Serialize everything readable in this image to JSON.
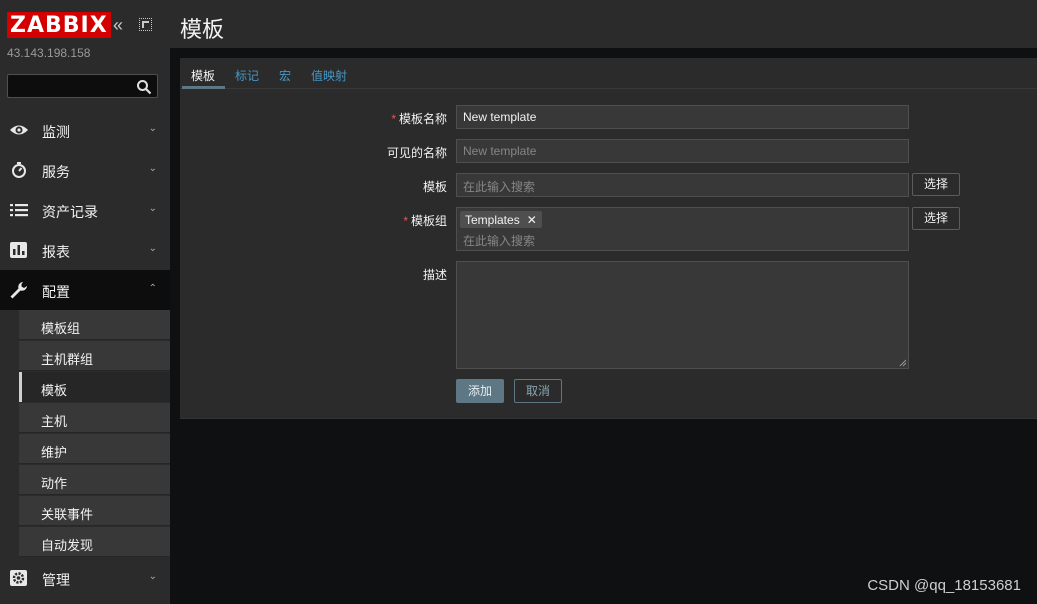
{
  "sidebar": {
    "logo": "ZABBIX",
    "collapse_glyph": "«",
    "server_ip": "43.143.198.158",
    "search": {
      "value": "",
      "placeholder": ""
    },
    "nav": [
      {
        "label": "监测",
        "icon": "eye-icon"
      },
      {
        "label": "服务",
        "icon": "stopwatch-icon"
      },
      {
        "label": "资产记录",
        "icon": "list-icon"
      },
      {
        "label": "报表",
        "icon": "bar-chart-icon"
      },
      {
        "label": "配置",
        "icon": "wrench-icon"
      },
      {
        "label": "管理",
        "icon": "gear-icon"
      }
    ],
    "config_sub": [
      {
        "label": "模板组"
      },
      {
        "label": "主机群组"
      },
      {
        "label": "模板"
      },
      {
        "label": "主机"
      },
      {
        "label": "维护"
      },
      {
        "label": "动作"
      },
      {
        "label": "关联事件"
      },
      {
        "label": "自动发现"
      }
    ]
  },
  "header": {
    "title": "模板"
  },
  "tabs": [
    {
      "label": "模板"
    },
    {
      "label": "标记"
    },
    {
      "label": "宏"
    },
    {
      "label": "值映射"
    }
  ],
  "form": {
    "template_name": {
      "label": "模板名称",
      "value": "New template"
    },
    "visible_name": {
      "label": "可见的名称",
      "placeholder": "New template"
    },
    "templates": {
      "label": "模板",
      "placeholder": "在此输入搜索",
      "select_label": "选择"
    },
    "groups": {
      "label": "模板组",
      "chip": "Templates",
      "placeholder": "在此输入搜索",
      "select_label": "选择"
    },
    "description": {
      "label": "描述",
      "value": ""
    },
    "add_label": "添加",
    "cancel_label": "取消"
  },
  "watermark": "CSDN @qq_18153681",
  "colors": {
    "logo_red": "#d40000",
    "accent_blue": "#4796c4",
    "primary_button": "#5d7785",
    "required_star": "#e45959"
  }
}
